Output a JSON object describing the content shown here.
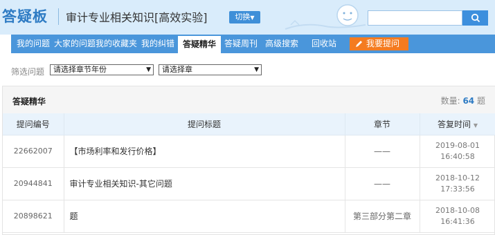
{
  "header": {
    "logo": "答疑板",
    "subject": "审计专业相关知识[高效实验]",
    "switch_label": "切换",
    "search_placeholder": ""
  },
  "nav": {
    "items": [
      "我的问题",
      "大家的问题",
      "我的收藏夹",
      "我的纠错",
      "答疑精华",
      "答疑周刊",
      "高级搜索",
      "回收站"
    ],
    "active": "答疑精华",
    "ask_label": "我要提问"
  },
  "filter": {
    "label": "筛选问题",
    "select_year": "请选择章节年份",
    "select_chapter": "请选择章"
  },
  "panel": {
    "title": "答疑精华",
    "count_label": "数量:",
    "count_value": "64",
    "count_unit": "题"
  },
  "table": {
    "columns": [
      "提问编号",
      "提问标题",
      "章节",
      "答复时间"
    ],
    "rows": [
      {
        "id": "22662007",
        "title": "【市场利率和发行价格】",
        "chapter": "——",
        "date": "2019-08-01",
        "time": "16:40:58"
      },
      {
        "id": "20944841",
        "title": "审计专业相关知识-其它问题",
        "chapter": "——",
        "date": "2018-10-12",
        "time": "17:33:56"
      },
      {
        "id": "20898621",
        "title": "题",
        "chapter": "第三部分第二章",
        "date": "2018-10-08",
        "time": "16:41:36"
      }
    ]
  },
  "colors": {
    "header_bg": "#d9ecfb",
    "nav_bg": "#4a96db",
    "accent": "#2f7cc4",
    "ask_button": "#f47b20"
  }
}
